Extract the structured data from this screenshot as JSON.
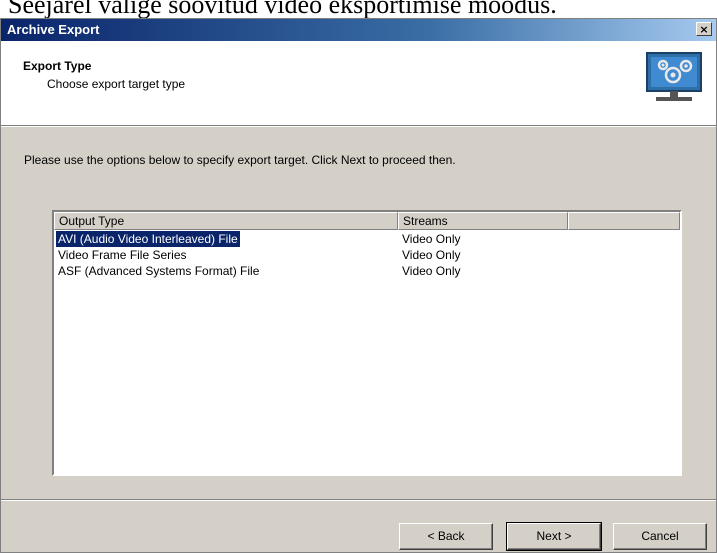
{
  "caption": "Seejärel valige soovitud video eksportimise moodus.",
  "window": {
    "title": "Archive Export",
    "close_label": "×"
  },
  "header": {
    "title": "Export Type",
    "subtitle": "Choose export target type",
    "icon": "gears-monitor-icon"
  },
  "instruction": "Please use the options below to specify export target. Click Next to proceed then.",
  "list": {
    "columns": [
      "Output Type",
      "Streams",
      ""
    ],
    "rows": [
      {
        "type": "AVI (Audio Video Interleaved) File",
        "streams": "Video Only",
        "selected": true
      },
      {
        "type": "Video Frame File Series",
        "streams": "Video Only",
        "selected": false
      },
      {
        "type": "ASF (Advanced Systems Format) File",
        "streams": "Video Only",
        "selected": false
      }
    ]
  },
  "buttons": {
    "back": "< Back",
    "next": "Next >",
    "cancel": "Cancel"
  },
  "colors": {
    "titlebar": "#0a246a",
    "selection": "#0a246a",
    "face": "#d4d0c8"
  }
}
